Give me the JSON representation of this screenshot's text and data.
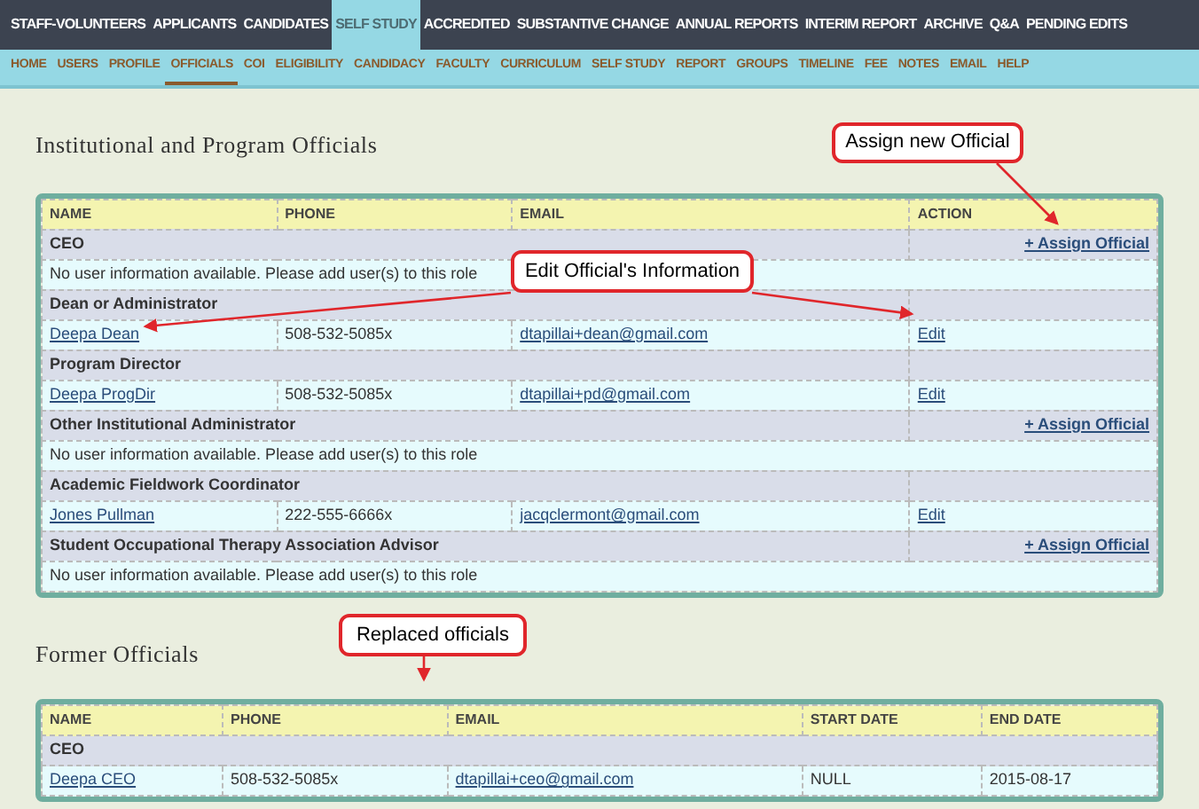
{
  "nav": {
    "items": [
      {
        "label": "STAFF-VOLUNTEERS",
        "selected": false
      },
      {
        "label": "APPLICANTS",
        "selected": false
      },
      {
        "label": "CANDIDATES",
        "selected": false
      },
      {
        "label": "SELF STUDY",
        "selected": true
      },
      {
        "label": "ACCREDITED",
        "selected": false
      },
      {
        "label": "SUBSTANTIVE CHANGE",
        "selected": false
      },
      {
        "label": "ANNUAL REPORTS",
        "selected": false
      },
      {
        "label": "INTERIM REPORT",
        "selected": false
      },
      {
        "label": "ARCHIVE",
        "selected": false
      },
      {
        "label": "Q&A",
        "selected": false
      },
      {
        "label": "PENDING EDITS",
        "selected": false
      }
    ]
  },
  "subnav": {
    "items": [
      {
        "label": "HOME",
        "selected": false
      },
      {
        "label": "USERS",
        "selected": false
      },
      {
        "label": "PROFILE",
        "selected": false
      },
      {
        "label": "OFFICIALS",
        "selected": true
      },
      {
        "label": "COI",
        "selected": false
      },
      {
        "label": "ELIGIBILITY",
        "selected": false
      },
      {
        "label": "CANDIDACY",
        "selected": false
      },
      {
        "label": "FACULTY",
        "selected": false
      },
      {
        "label": "CURRICULUM",
        "selected": false
      },
      {
        "label": "SELF STUDY",
        "selected": false
      },
      {
        "label": "REPORT",
        "selected": false
      },
      {
        "label": "GROUPS",
        "selected": false
      },
      {
        "label": "TIMELINE",
        "selected": false
      },
      {
        "label": "FEE",
        "selected": false
      },
      {
        "label": "NOTES",
        "selected": false
      },
      {
        "label": "EMAIL",
        "selected": false
      },
      {
        "label": "HELP",
        "selected": false
      }
    ]
  },
  "officials": {
    "title": "Institutional and Program Officials",
    "columns": [
      "NAME",
      "PHONE",
      "EMAIL",
      "ACTION"
    ],
    "rows": [
      {
        "kind": "role",
        "label": "CEO",
        "action": "+ Assign Official"
      },
      {
        "kind": "empty",
        "text": "No user information available. Please add user(s) to this role"
      },
      {
        "kind": "role",
        "label": "Dean or Administrator"
      },
      {
        "kind": "person",
        "name": "Deepa Dean",
        "phone": "508-532-5085x",
        "email": "dtapillai+dean@gmail.com",
        "action": "Edit"
      },
      {
        "kind": "role",
        "label": "Program Director"
      },
      {
        "kind": "person",
        "name": "Deepa ProgDir",
        "phone": "508-532-5085x",
        "email": "dtapillai+pd@gmail.com",
        "action": "Edit"
      },
      {
        "kind": "role",
        "label": "Other Institutional Administrator",
        "action": "+ Assign Official"
      },
      {
        "kind": "empty",
        "text": "No user information available. Please add user(s) to this role"
      },
      {
        "kind": "role",
        "label": "Academic Fieldwork Coordinator"
      },
      {
        "kind": "person",
        "name": "Jones Pullman",
        "phone": "222-555-6666x",
        "email": "jacqclermont@gmail.com",
        "action": "Edit"
      },
      {
        "kind": "role",
        "label": "Student Occupational Therapy Association Advisor",
        "action": "+ Assign Official"
      },
      {
        "kind": "empty",
        "text": "No user information available. Please add user(s) to this role"
      }
    ]
  },
  "former": {
    "title": "Former Officials",
    "columns": [
      "NAME",
      "PHONE",
      "EMAIL",
      "START DATE",
      "END DATE"
    ],
    "rows": [
      {
        "kind": "role",
        "label": "CEO"
      },
      {
        "kind": "person",
        "name": "Deepa CEO",
        "phone": "508-532-5085x",
        "email": "dtapillai+ceo@gmail.com",
        "start_date": "NULL",
        "end_date": "2015-08-17"
      }
    ]
  },
  "callouts": [
    {
      "text": "Assign new Official"
    },
    {
      "text": "Edit Official's Information"
    },
    {
      "text": "Replaced officials"
    }
  ]
}
